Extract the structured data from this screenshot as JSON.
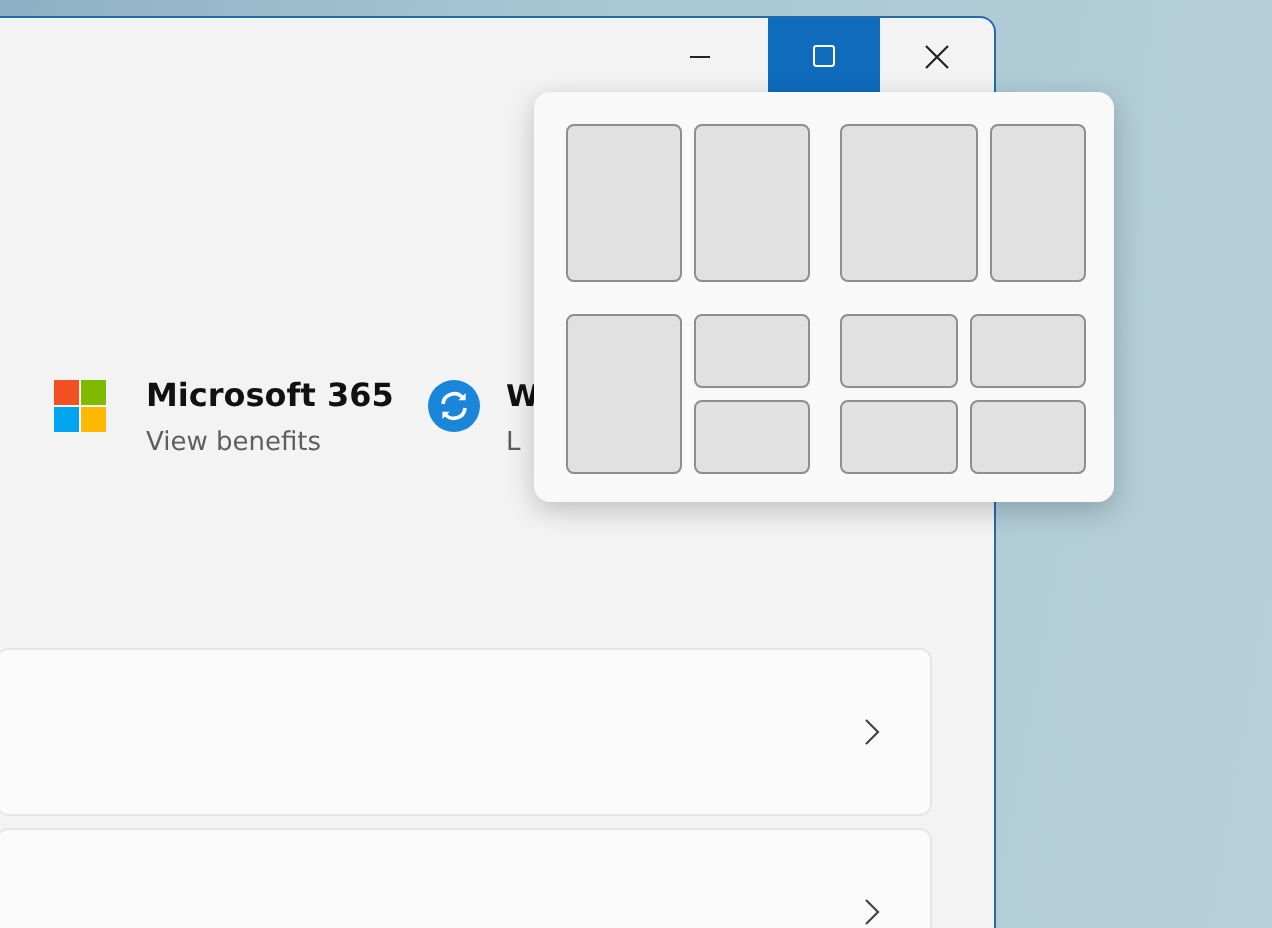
{
  "title_buttons": [
    {
      "kind": "minimize",
      "highlighted": false
    },
    {
      "kind": "maximize",
      "highlighted": true
    },
    {
      "kind": "close",
      "highlighted": false
    }
  ],
  "links": [
    {
      "kind": "office",
      "title": "Microsoft 365",
      "subtitle": "View benefits"
    },
    {
      "kind": "update",
      "title": "W",
      "subtitle": "L"
    }
  ],
  "cards": [
    {
      "kind": "link"
    },
    {
      "kind": "link"
    }
  ],
  "snap_layouts": [
    {
      "kind": "halves"
    },
    {
      "kind": "two-thirds"
    },
    {
      "kind": "left-and-stack"
    },
    {
      "kind": "quarters"
    }
  ]
}
